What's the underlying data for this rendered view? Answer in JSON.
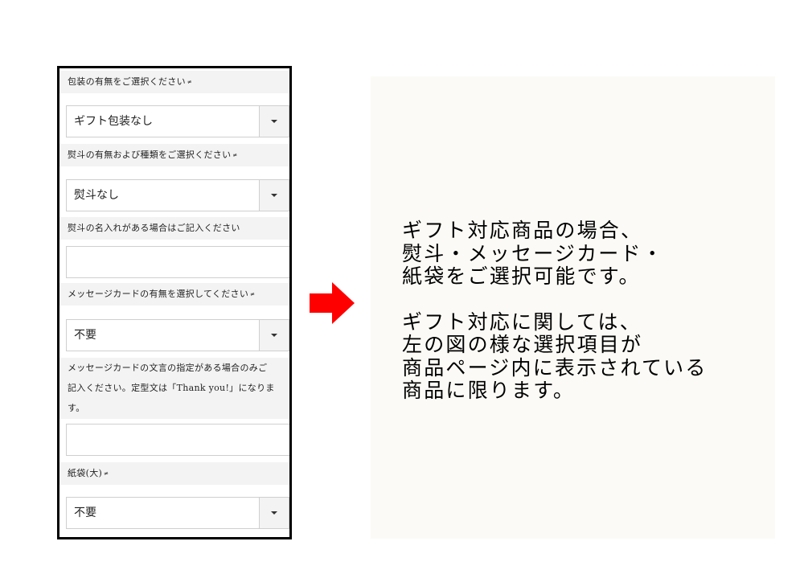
{
  "form": {
    "wrapping": {
      "label": "包装の有無をご選択ください",
      "required_mark": "≠",
      "value": "ギフト包装なし"
    },
    "noshi": {
      "label": "熨斗の有無および種類をご選択ください",
      "required_mark": "≠",
      "value": "熨斗なし"
    },
    "noshi_name": {
      "label": "熨斗の名入れがある場合はご記入ください",
      "value": ""
    },
    "message_card": {
      "label": "メッセージカードの有無を選択してください",
      "required_mark": "≠",
      "value": "不要"
    },
    "message_text": {
      "label_line1": "メッセージカードの文言の指定がある場合のみご",
      "label_line2": "記入ください。定型文は「Thank you!」になりま",
      "label_line3": "す。",
      "value": ""
    },
    "paper_bag": {
      "label": "紙袋(大)",
      "required_mark": "≠",
      "value": "不要"
    }
  },
  "note": {
    "p1_line1": "ギフト対応商品の場合、",
    "p1_line2": "熨斗・メッセージカード・",
    "p1_line3": "紙袋をご選択可能です。",
    "p2_line1": "ギフト対応に関しては、",
    "p2_line2": "左の図の様な選択項目が",
    "p2_line3": "商品ページ内に表示されている",
    "p2_line4": "商品に限ります。"
  },
  "colors": {
    "arrow": "#ff0000",
    "label_bg": "#f3f3f3",
    "panel_bg": "#fbfaf6"
  }
}
